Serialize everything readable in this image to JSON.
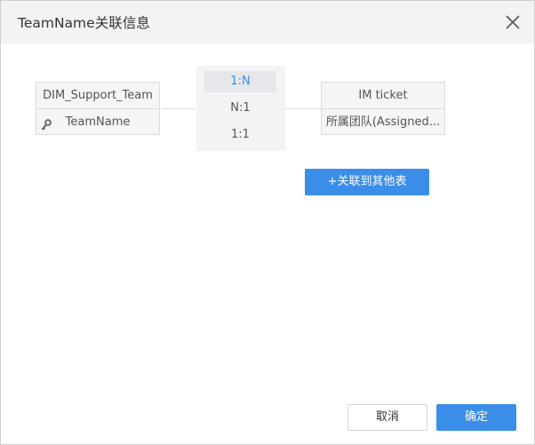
{
  "dialog": {
    "title": "TeamName关联信息"
  },
  "left_table": {
    "name": "DIM_Support_Team",
    "field": "TeamName",
    "field_icon": "key-icon"
  },
  "right_table": {
    "name": "IM ticket",
    "field": "所属团队(Assigned..."
  },
  "relationship": {
    "options": [
      "1:N",
      "N:1",
      "1:1"
    ],
    "selected": "1:N"
  },
  "actions": {
    "link_other_label": "+关联到其他表",
    "cancel_label": "取消",
    "ok_label": "确定"
  },
  "colors": {
    "primary": "#3b8ee8",
    "selected_text": "#3f8ce0",
    "header_bg": "#f3f3f5"
  }
}
